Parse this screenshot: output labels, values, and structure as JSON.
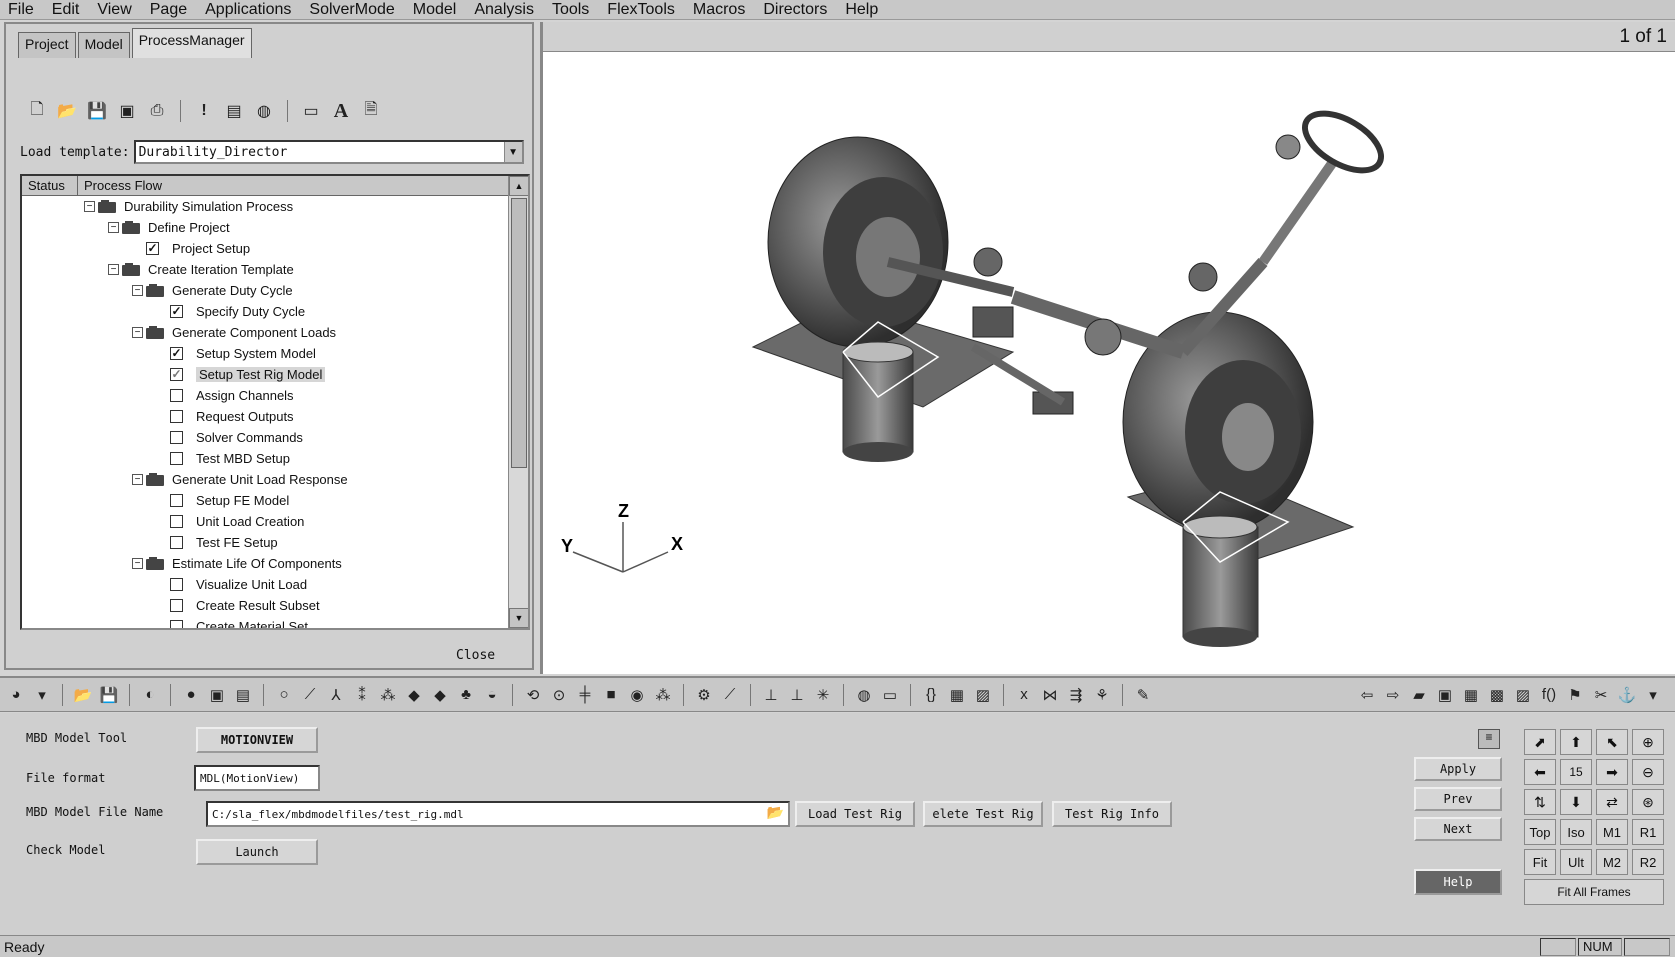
{
  "menu": [
    "File",
    "Edit",
    "View",
    "Page",
    "Applications",
    "SolverMode",
    "Model",
    "Analysis",
    "Tools",
    "FlexTools",
    "Macros",
    "Directors",
    "Help"
  ],
  "tabs": [
    "Project",
    "Model",
    "ProcessManager"
  ],
  "toolbar1_icons": [
    "new-icon",
    "open-icon",
    "save-icon",
    "save-as-icon",
    "export-icon",
    "exclamation-icon",
    "properties-icon",
    "globe-icon",
    "window-icon",
    "text-icon",
    "document-icon"
  ],
  "load_template": {
    "label": "Load template:",
    "value": "Durability_Director"
  },
  "tree": {
    "headers": [
      "Status",
      "Process Flow"
    ],
    "nodes": [
      {
        "label": "Durability Simulation Process",
        "level": 0,
        "type": "folder"
      },
      {
        "label": "Define Project",
        "level": 1,
        "type": "folder"
      },
      {
        "label": "Project Setup",
        "level": 2,
        "type": "check",
        "checked": true
      },
      {
        "label": "Create Iteration Template",
        "level": 1,
        "type": "folder"
      },
      {
        "label": "Generate Duty Cycle",
        "level": 2,
        "type": "folder"
      },
      {
        "label": "Specify Duty Cycle",
        "level": 3,
        "type": "check",
        "checked": true
      },
      {
        "label": "Generate Component Loads",
        "level": 2,
        "type": "folder"
      },
      {
        "label": "Setup System Model",
        "level": 3,
        "type": "check",
        "checked": true
      },
      {
        "label": "Setup Test Rig Model",
        "level": 3,
        "type": "check",
        "checked": "partial",
        "selected": true
      },
      {
        "label": "Assign Channels",
        "level": 3,
        "type": "check",
        "checked": false
      },
      {
        "label": "Request Outputs",
        "level": 3,
        "type": "check",
        "checked": false
      },
      {
        "label": "Solver Commands",
        "level": 3,
        "type": "check",
        "checked": false
      },
      {
        "label": "Test MBD Setup",
        "level": 3,
        "type": "check",
        "checked": false
      },
      {
        "label": "Generate Unit Load Response",
        "level": 2,
        "type": "folder"
      },
      {
        "label": "Setup FE Model",
        "level": 3,
        "type": "check",
        "checked": false
      },
      {
        "label": "Unit Load Creation",
        "level": 3,
        "type": "check",
        "checked": false
      },
      {
        "label": "Test FE Setup",
        "level": 3,
        "type": "check",
        "checked": false
      },
      {
        "label": "Estimate Life Of Components",
        "level": 2,
        "type": "folder"
      },
      {
        "label": "Visualize Unit Load",
        "level": 3,
        "type": "check",
        "checked": false
      },
      {
        "label": "Create Result Subset",
        "level": 3,
        "type": "check",
        "checked": false
      },
      {
        "label": "Create Material Set",
        "level": 3,
        "type": "check",
        "checked": false
      }
    ]
  },
  "close_label": "Close",
  "page_indicator": "1 of 1",
  "triad": {
    "z": "Z",
    "y": "Y",
    "x": "X"
  },
  "form": {
    "mbd_tool_label": "MBD Model Tool",
    "mbd_tool_value": "MOTIONVIEW",
    "file_format_label": "File format",
    "file_format_value": "MDL(MotionView)",
    "file_name_label": "MBD Model File Name",
    "file_name_value": "C:/sla_flex/mbdmodelfiles/test_rig.mdl",
    "load_test_rig": "Load Test Rig",
    "delete_test_rig": "elete Test Rig",
    "test_rig_info": "Test Rig Info",
    "check_model_label": "Check Model",
    "launch": "Launch"
  },
  "actions": {
    "apply": "Apply",
    "prev": "Prev",
    "next": "Next",
    "help": "Help"
  },
  "view_controls": {
    "step": "15",
    "row3": [
      "Top",
      "Iso",
      "M1",
      "R1"
    ],
    "row4": [
      "Fit",
      "Ult",
      "M2",
      "R2"
    ],
    "fit_all": "Fit All Frames"
  },
  "status": {
    "text": "Ready",
    "num": "NUM"
  }
}
